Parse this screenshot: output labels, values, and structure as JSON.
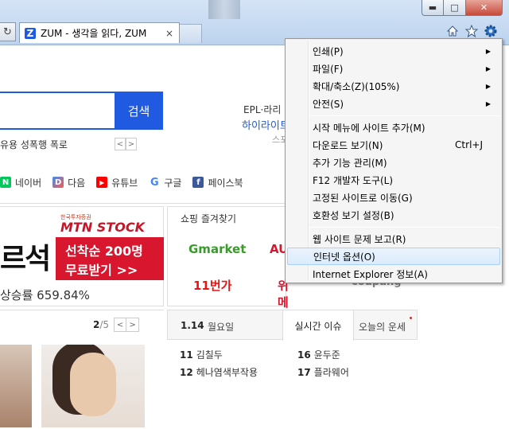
{
  "window": {
    "min_label": "▬",
    "max_label": "□",
    "close_label": "✕"
  },
  "tab": {
    "logo": "Z",
    "title": "ZUM - 생각을 읽다, ZUM",
    "close": "×"
  },
  "toolbar": {
    "refresh": "↻",
    "icons": [
      "home-icon",
      "star-icon",
      "gear-icon"
    ]
  },
  "search": {
    "button": "검색",
    "trend": "유용 성폭행 폭로",
    "nav_prev": "<",
    "nav_next": ">"
  },
  "side": {
    "epl": "EPL·라리",
    "highlight": "하이라이트",
    "small": "스포"
  },
  "shortcuts": [
    {
      "label": "네이버",
      "icon": "N",
      "color": "#03c75a"
    },
    {
      "label": "다음",
      "icon": "D",
      "color": "#ff5a4a"
    },
    {
      "label": "유튜브",
      "icon": "▶",
      "color": "#ff0000"
    },
    {
      "label": "구글",
      "icon": "G",
      "color": "#ffffff"
    },
    {
      "label": "페이스북",
      "icon": "f",
      "color": "#3b5998"
    }
  ],
  "banner": {
    "big": "르석",
    "tag": "한국투자증권",
    "brand": "MTN STOCK",
    "line1": "선착순 200명",
    "line2": "무료받기  >>",
    "rate": "상승률 659.84%"
  },
  "shopping": {
    "title": "쇼핑 즐겨찾기",
    "gmarket": "Gmarket",
    "auction": "AU",
    "st11": "11번가",
    "wemake": "위메",
    "coupang": "coupang"
  },
  "gallery": {
    "current": "2",
    "total": "/5",
    "prev": "<",
    "next": ">"
  },
  "realtime": {
    "date": "1.14",
    "weekday": "월요일",
    "tab_live": "실시간 이슈",
    "tab_fortune": "오늘의 운세",
    "ranks": [
      {
        "n": "11",
        "t": "김칠두"
      },
      {
        "n": "16",
        "t": "윤두준"
      },
      {
        "n": "12",
        "t": "헤나염색부작용"
      },
      {
        "n": "17",
        "t": "플라웨어"
      }
    ]
  },
  "menu": {
    "items": [
      {
        "label": "인쇄(P)",
        "submenu": true
      },
      {
        "label": "파일(F)",
        "submenu": true
      },
      {
        "label": "확대/축소(Z)(105%)",
        "submenu": true
      },
      {
        "label": "안전(S)",
        "submenu": true
      },
      {
        "label": "시작 메뉴에 사이트 추가(M)"
      },
      {
        "label": "다운로드 보기(N)",
        "shortcut": "Ctrl+J"
      },
      {
        "label": "추가 기능 관리(M)"
      },
      {
        "label": "F12 개발자 도구(L)"
      },
      {
        "label": "고정된 사이트로 이동(G)"
      },
      {
        "label": "호환성 보기 설정(B)"
      },
      {
        "label": "웹 사이트 문제 보고(R)"
      },
      {
        "label": "인터넷 옵션(O)",
        "highlighted": true
      },
      {
        "label": "Internet Explorer 정보(A)"
      }
    ],
    "submenu_arrow": "▶"
  }
}
